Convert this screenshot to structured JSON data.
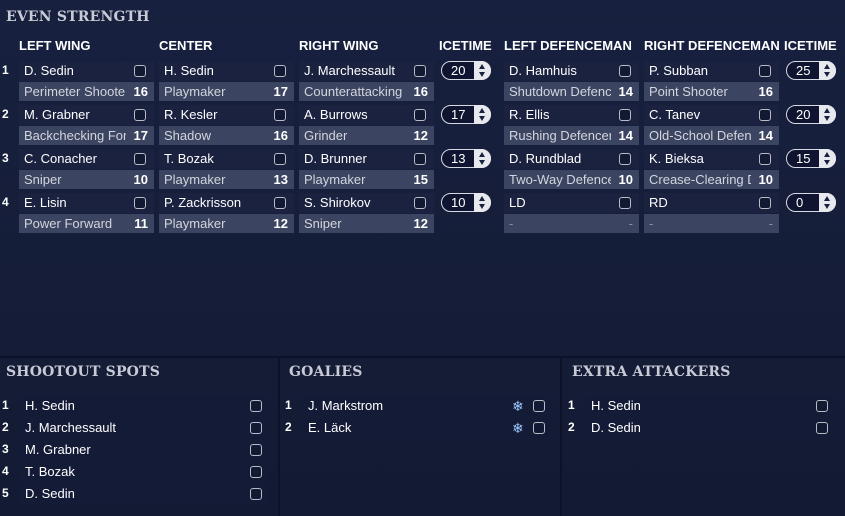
{
  "even_strength": {
    "title": "EVEN STRENGTH",
    "headers": {
      "left_wing": "LEFT WING",
      "center": "CENTER",
      "right_wing": "RIGHT WING",
      "icetime_fwd": "ICETIME",
      "left_def": "LEFT DEFENCEMAN",
      "right_def": "RIGHT DEFENCEMAN",
      "icetime_def": "ICETIME"
    },
    "forward_lines": [
      {
        "num": "1",
        "lw": {
          "name": "D. Sedin",
          "role": "Perimeter Shooter",
          "rating": "16"
        },
        "c": {
          "name": "H. Sedin",
          "role": "Playmaker",
          "rating": "17"
        },
        "rw": {
          "name": "J. Marchessault",
          "role": "Counterattacking",
          "rating": "16"
        },
        "icetime": "20"
      },
      {
        "num": "2",
        "lw": {
          "name": "M. Grabner",
          "role": "Backchecking Forward",
          "rating": "17"
        },
        "c": {
          "name": "R. Kesler",
          "role": "Shadow",
          "rating": "16"
        },
        "rw": {
          "name": "A. Burrows",
          "role": "Grinder",
          "rating": "12"
        },
        "icetime": "17"
      },
      {
        "num": "3",
        "lw": {
          "name": "C. Conacher",
          "role": "Sniper",
          "rating": "10"
        },
        "c": {
          "name": "T. Bozak",
          "role": "Playmaker",
          "rating": "13"
        },
        "rw": {
          "name": "D. Brunner",
          "role": "Playmaker",
          "rating": "15"
        },
        "icetime": "13"
      },
      {
        "num": "4",
        "lw": {
          "name": "E. Lisin",
          "role": "Power Forward",
          "rating": "11"
        },
        "c": {
          "name": "P. Zackrisson",
          "role": "Playmaker",
          "rating": "12"
        },
        "rw": {
          "name": "S. Shirokov",
          "role": "Sniper",
          "rating": "12"
        },
        "icetime": "10"
      }
    ],
    "defence_pairs": [
      {
        "ld": {
          "name": "D. Hamhuis",
          "role": "Shutdown Defenceman",
          "rating": "14"
        },
        "rd": {
          "name": "P. Subban",
          "role": "Point Shooter",
          "rating": "16"
        },
        "icetime": "25"
      },
      {
        "ld": {
          "name": "R. Ellis",
          "role": "Rushing Defenceman",
          "rating": "14"
        },
        "rd": {
          "name": "C. Tanev",
          "role": "Old-School Defenceman",
          "rating": "14"
        },
        "icetime": "20"
      },
      {
        "ld": {
          "name": "D. Rundblad",
          "role": "Two-Way Defenceman",
          "rating": "10"
        },
        "rd": {
          "name": "K. Bieksa",
          "role": "Crease-Clearing Defenceman",
          "rating": "10"
        },
        "icetime": "15"
      },
      {
        "ld": {
          "name": "LD",
          "role": "-",
          "rating": "-"
        },
        "rd": {
          "name": "RD",
          "role": "-",
          "rating": "-"
        },
        "icetime": "0"
      }
    ]
  },
  "shootout": {
    "title": "SHOOTOUT SPOTS",
    "items": [
      {
        "num": "1",
        "name": "H. Sedin"
      },
      {
        "num": "2",
        "name": "J. Marchessault"
      },
      {
        "num": "3",
        "name": "M. Grabner"
      },
      {
        "num": "4",
        "name": "T. Bozak"
      },
      {
        "num": "5",
        "name": "D. Sedin"
      }
    ]
  },
  "goalies": {
    "title": "GOALIES",
    "items": [
      {
        "num": "1",
        "name": "J. Markstrom"
      },
      {
        "num": "2",
        "name": "E. Läck"
      }
    ]
  },
  "extra_attackers": {
    "title": "EXTRA ATTACKERS",
    "items": [
      {
        "num": "1",
        "name": "H. Sedin"
      },
      {
        "num": "2",
        "name": "D. Sedin"
      }
    ]
  }
}
